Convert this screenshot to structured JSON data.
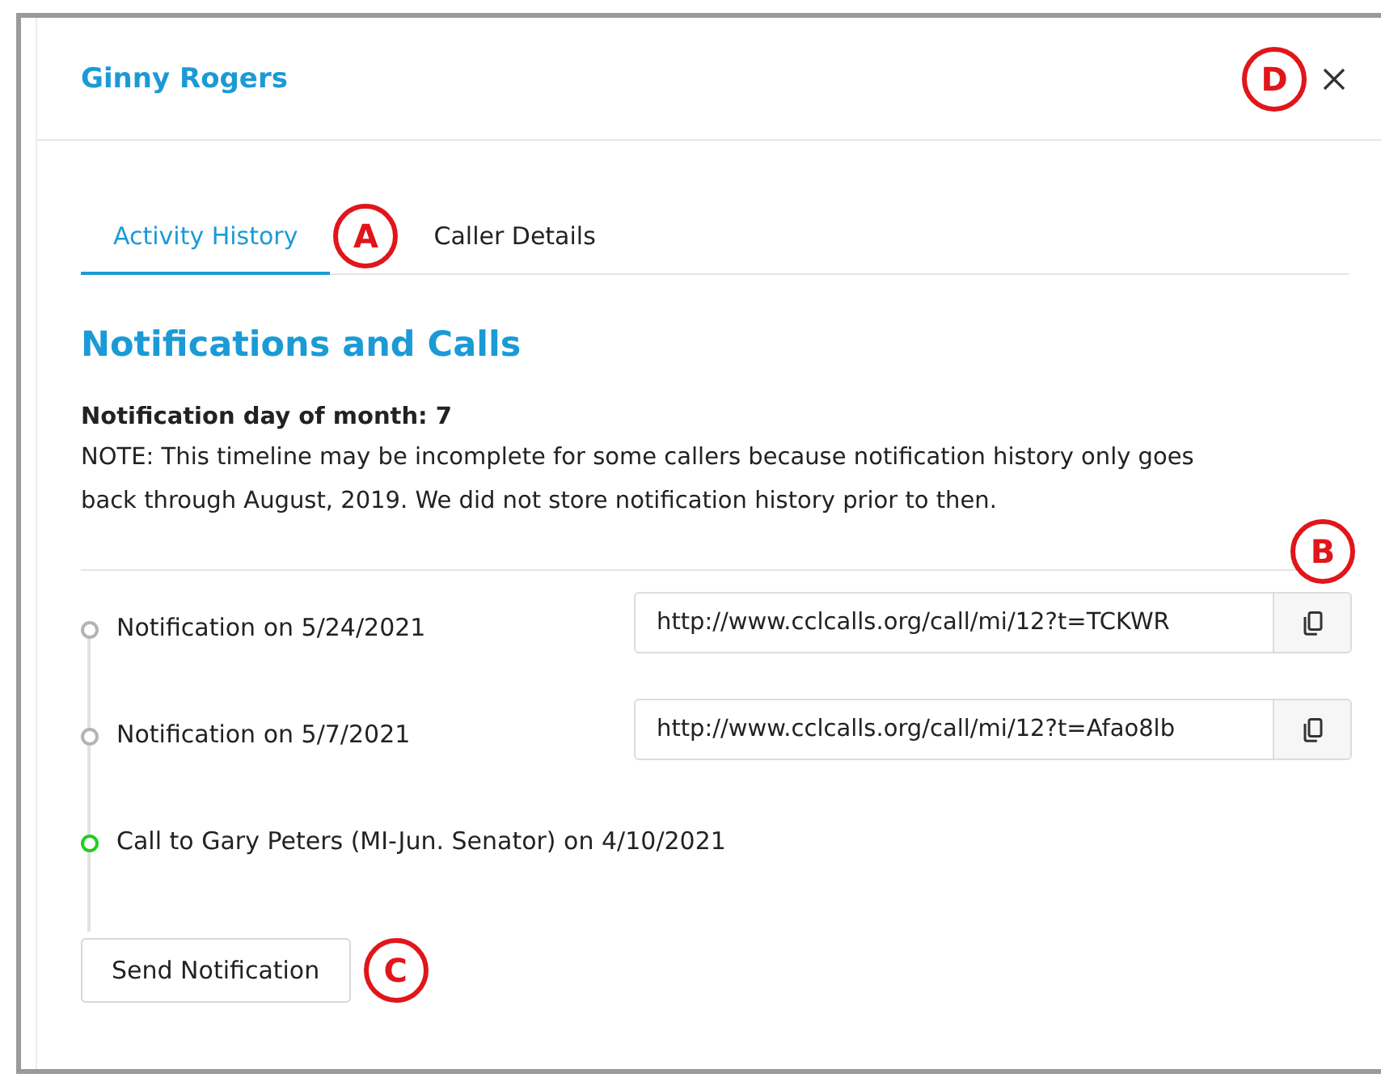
{
  "dialog": {
    "title": "Ginny Rogers",
    "close_callout": "D"
  },
  "tabs": [
    {
      "label": "Activity History",
      "selected": true,
      "callout": "A"
    },
    {
      "label": "Caller Details",
      "selected": false
    }
  ],
  "section": {
    "heading": "Notifications and Calls",
    "day_line": "Notification day of month: 7",
    "note": "NOTE: This timeline may be incomplete for some callers because notification history only goes back through August, 2019. We did not store notification history prior to then."
  },
  "timeline": [
    {
      "kind": "notification",
      "text": "Notification on 5/24/2021",
      "color": "#b4b4b4",
      "url": "http://www.cclcalls.org/call/mi/12?t=TCKWR",
      "callout": "B"
    },
    {
      "kind": "notification",
      "text": "Notification on 5/7/2021",
      "color": "#b4b4b4",
      "url": "http://www.cclcalls.org/call/mi/12?t=Afao8lb"
    },
    {
      "kind": "call",
      "text": "Call to Gary Peters (MI-Jun. Senator) on 4/10/2021",
      "color": "#22cc22"
    }
  ],
  "button": {
    "label": "Send Notification",
    "callout": "C"
  }
}
